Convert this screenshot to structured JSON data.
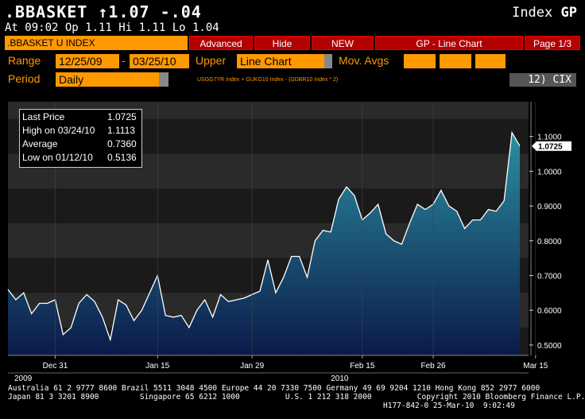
{
  "header": {
    "ticker": ".BBASKET",
    "change": "↑1.07 -.04",
    "index_word": "Index",
    "index_code": "GP",
    "quote": "At 09:02  Op 1.11 Hi 1.11 Lo 1.04"
  },
  "toolbar": {
    "security": ".BBASKET U INDEX",
    "advanced": "Advanced",
    "hide": "Hide",
    "new": "NEW",
    "title": "GP - Line Chart",
    "page": "Page 1/3"
  },
  "controls": {
    "range_label": "Range",
    "range_start": "12/25/09",
    "range_sep": "-",
    "range_end": "03/25/10",
    "upper_label": "Upper",
    "upper_value": "Line Chart",
    "mov_avgs_label": "Mov. Avgs",
    "period_label": "Period",
    "period_value": "Daily",
    "formula": "USGG7YR Index + GUKG10 Index - (GDBR10 Index * 2)",
    "cix": "12) CIX"
  },
  "stats": {
    "rows": [
      {
        "label": "Last Price",
        "value": "1.0725"
      },
      {
        "label": "High on 03/24/10",
        "value": "1.1113"
      },
      {
        "label": "Average",
        "value": "0.7360"
      },
      {
        "label": "Low on 01/12/10",
        "value": "0.5136"
      }
    ]
  },
  "chart_data": {
    "type": "area",
    "x_tick_labels": [
      "Dec 31",
      "Jan 15",
      "Jan 29",
      "Feb 15",
      "Feb 26",
      "Mar 15"
    ],
    "year_labels": [
      "2009",
      "2010"
    ],
    "y_tick_labels": [
      "1.1000",
      "1.0000",
      "0.9000",
      "0.8000",
      "0.7000",
      "0.6000",
      "0.5000"
    ],
    "last_price_label": "1.0725",
    "ylim": [
      0.47,
      1.2
    ],
    "y_ticks": [
      1.1,
      1.0,
      0.9,
      0.8,
      0.7,
      0.6,
      0.5
    ],
    "x_tick_index": [
      6,
      19,
      31,
      45,
      54,
      67
    ],
    "values": [
      0.66,
      0.63,
      0.65,
      0.59,
      0.62,
      0.62,
      0.63,
      0.53,
      0.55,
      0.62,
      0.645,
      0.625,
      0.58,
      0.515,
      0.63,
      0.615,
      0.57,
      0.6,
      0.65,
      0.7,
      0.585,
      0.58,
      0.585,
      0.55,
      0.6,
      0.63,
      0.58,
      0.645,
      0.625,
      0.63,
      0.635,
      0.645,
      0.655,
      0.745,
      0.65,
      0.695,
      0.755,
      0.755,
      0.695,
      0.8,
      0.83,
      0.825,
      0.92,
      0.955,
      0.93,
      0.86,
      0.88,
      0.905,
      0.82,
      0.8,
      0.79,
      0.85,
      0.905,
      0.89,
      0.905,
      0.945,
      0.9,
      0.885,
      0.835,
      0.86,
      0.86,
      0.89,
      0.885,
      0.915,
      1.1113,
      1.0725
    ],
    "colors": {
      "line": "#ffffff",
      "fill_top": "#2b8fa0",
      "fill_bottom": "#0b1a4a"
    }
  },
  "footer": {
    "line1": "Australia 61 2 9777 8600 Brazil 5511 3048 4500 Europe 44 20 7330 7500 Germany 49 69 9204 1210 Hong Kong 852 2977 6000",
    "line2": "Japan 81 3 3201 8900         Singapore 65 6212 1000          U.S. 1 212 318 2000          Copyright 2010 Bloomberg Finance L.P.",
    "line3": "H177-842-0 25-Mar-10  9:02:49"
  }
}
